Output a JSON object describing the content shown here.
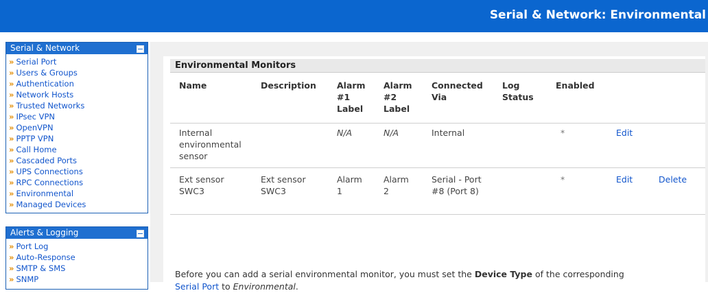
{
  "header": {
    "title": "Serial & Network: Environmental"
  },
  "colors": {
    "header_blue": "#0b66cf",
    "link_blue": "#1155cc",
    "nav_arrow": "#e08a00"
  },
  "sidebar": {
    "sections": [
      {
        "title": "Serial & Network",
        "items": [
          "Serial Port",
          "Users & Groups",
          "Authentication",
          "Network Hosts",
          "Trusted Networks",
          "IPsec VPN",
          "OpenVPN",
          "PPTP VPN",
          "Call Home",
          "Cascaded Ports",
          "UPS Connections",
          "RPC Connections",
          "Environmental",
          "Managed Devices"
        ]
      },
      {
        "title": "Alerts & Logging",
        "items": [
          "Port Log",
          "Auto-Response",
          "SMTP & SMS",
          "SNMP"
        ]
      }
    ]
  },
  "main": {
    "section_title": "Environmental Monitors",
    "columns": [
      "Name",
      "Description",
      "Alarm #1 Label",
      "Alarm #2 Label",
      "Connected Via",
      "Log Status",
      "Enabled"
    ],
    "rows": [
      {
        "name": "Internal environmental sensor",
        "description": "",
        "alarm1": "N/A",
        "alarm2": "N/A",
        "connected_via": "Internal",
        "log_status": "",
        "enabled": "*",
        "edit": "Edit",
        "delete": ""
      },
      {
        "name": "Ext sensor SWC3",
        "description": "Ext sensor SWC3",
        "alarm1": "Alarm 1",
        "alarm2": "Alarm 2",
        "connected_via": "Serial - Port #8 (Port 8)",
        "log_status": "",
        "enabled": "*",
        "edit": "Edit",
        "delete": "Delete"
      }
    ],
    "note": {
      "part1": "Before you can add a serial environmental monitor, you must set the ",
      "bold": "Device Type",
      "part2": " of the corresponding",
      "link": "Serial Port",
      "part3": " to ",
      "italic": "Environmental",
      "part4": "."
    }
  }
}
